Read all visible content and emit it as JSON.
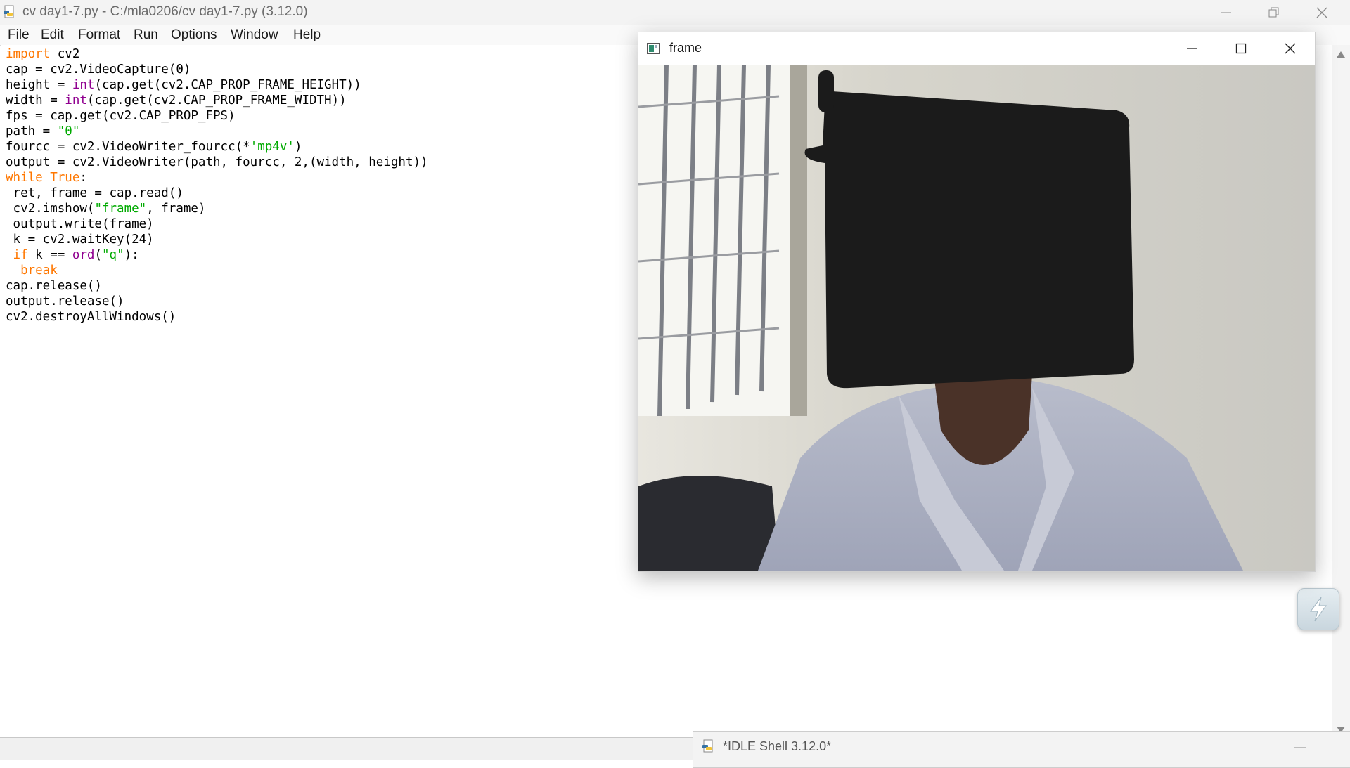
{
  "editor": {
    "title": "cv day1-7.py - C:/mla0206/cv day1-7.py (3.12.0)",
    "menu": [
      "File",
      "Edit",
      "Format",
      "Run",
      "Options",
      "Window",
      "Help"
    ]
  },
  "code": {
    "line1": {
      "kw": "import",
      "rest": " cv2"
    },
    "line2": "cap = cv2.VideoCapture(0)",
    "line3": {
      "a": "height = ",
      "bi": "int",
      "b": "(cap.get(cv2.CAP_PROP_FRAME_HEIGHT))"
    },
    "line4": {
      "a": "width = ",
      "bi": "int",
      "b": "(cap.get(cv2.CAP_PROP_FRAME_WIDTH))"
    },
    "line5": "fps = cap.get(cv2.CAP_PROP_FPS)",
    "line6": {
      "a": "path = ",
      "str": "\"0\""
    },
    "line7": {
      "a": "fourcc = cv2.VideoWriter_fourcc(*",
      "str": "'mp4v'",
      "b": ")"
    },
    "line8": "output = cv2.VideoWriter(path, fourcc, 2,(width, height))",
    "line9": {
      "kw1": "while",
      "mid": " ",
      "kw2": "True",
      "b": ":"
    },
    "line10": " ret, frame = cap.read()",
    "line11": {
      "a": " cv2.imshow(",
      "str": "\"frame\"",
      "b": ", frame)"
    },
    "line12": " output.write(frame)",
    "line13": " k = cv2.waitKey(24)",
    "line14": {
      "pre": " ",
      "kw": "if",
      "a": " k == ",
      "bi": "ord",
      "b": "(",
      "str": "\"q\"",
      "c": "):"
    },
    "line15": {
      "pre": "  ",
      "kw": "break"
    },
    "line16": "cap.release()",
    "line17": "output.release()",
    "line18": "cv2.destroyAllWindows()"
  },
  "frame_window": {
    "title": "frame",
    "icon": "opencv-window-icon"
  },
  "shell_window": {
    "title": "*IDLE Shell 3.12.0*"
  },
  "colors": {
    "keyword": "#ff7700",
    "builtin": "#900090",
    "string": "#00aa00"
  }
}
